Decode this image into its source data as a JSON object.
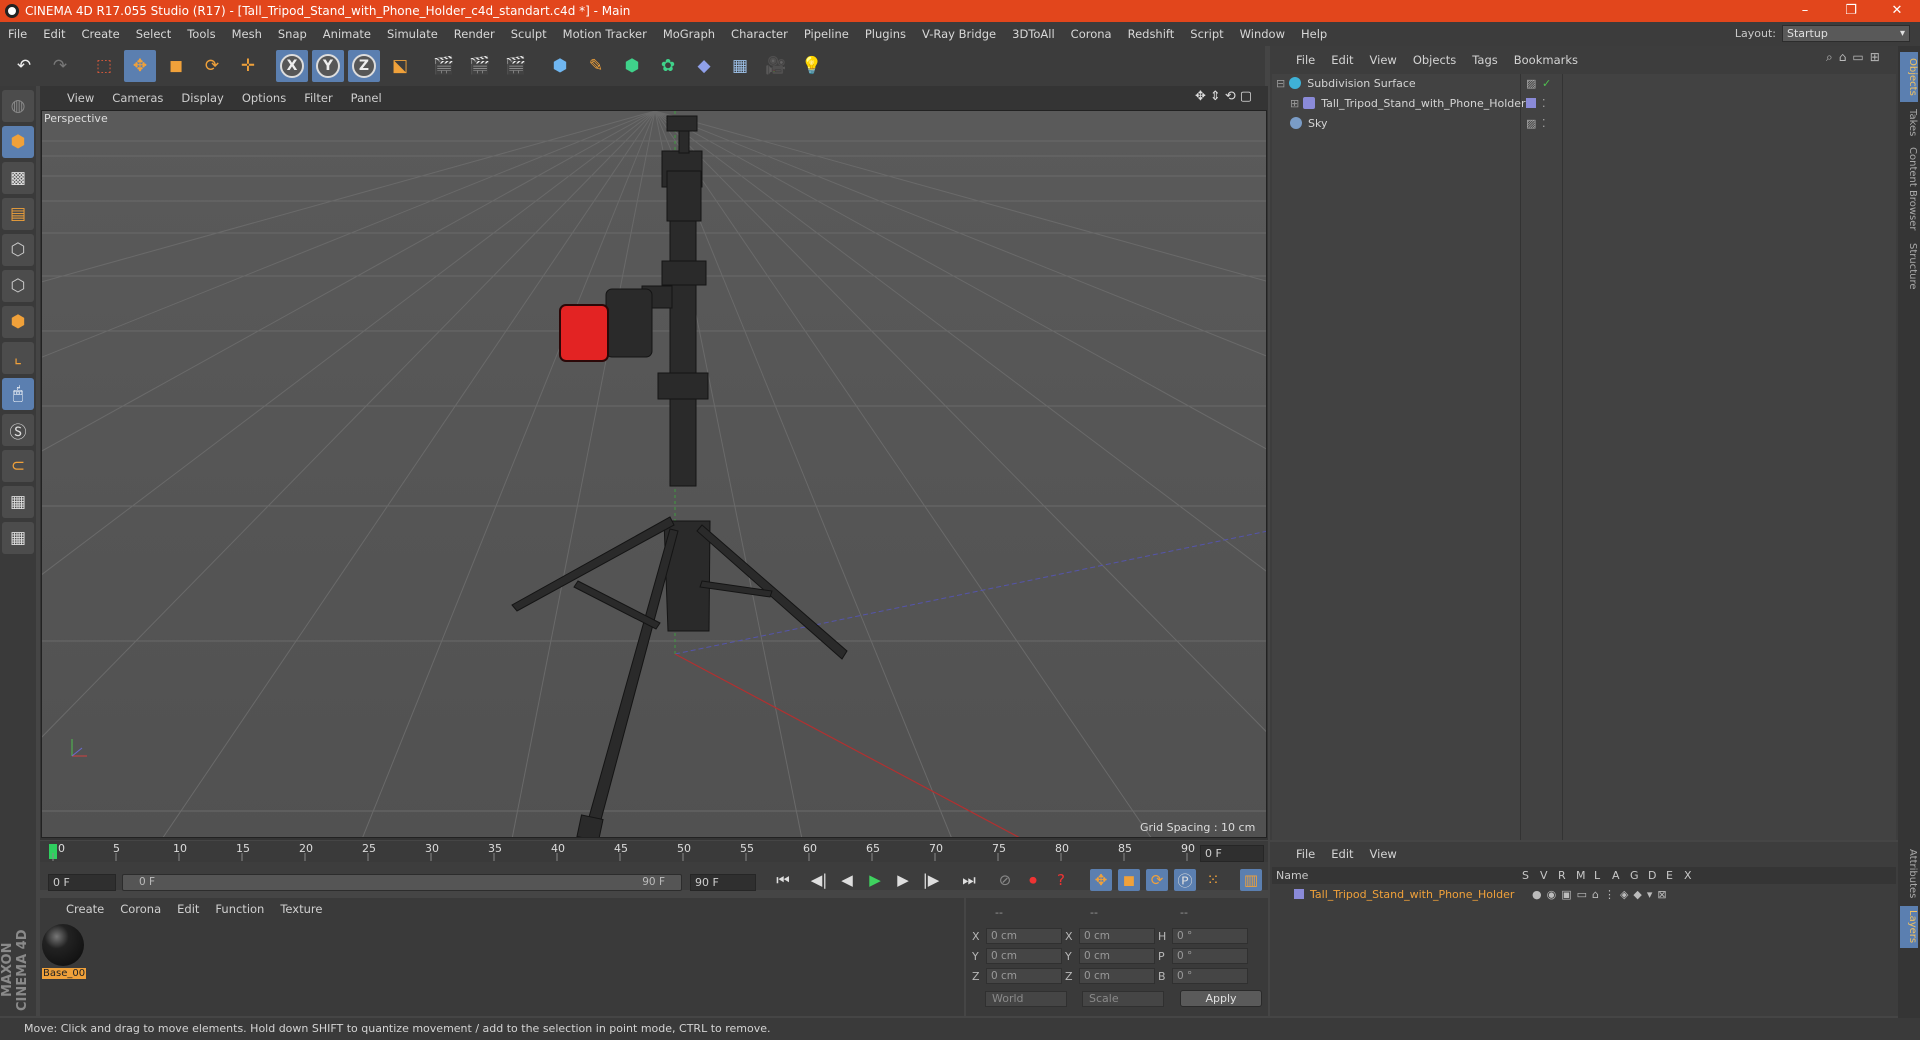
{
  "window": {
    "title": "CINEMA 4D R17.055 Studio (R17) - [Tall_Tripod_Stand_with_Phone_Holder_c4d_standart.c4d *] - Main",
    "controls": [
      "–",
      "❐",
      "✕"
    ]
  },
  "menubar": {
    "items": [
      "File",
      "Edit",
      "Create",
      "Select",
      "Tools",
      "Mesh",
      "Snap",
      "Animate",
      "Simulate",
      "Render",
      "Sculpt",
      "Motion Tracker",
      "MoGraph",
      "Character",
      "Pipeline",
      "Plugins",
      "V-Ray Bridge",
      "3DToAll",
      "Corona",
      "Redshift",
      "Script",
      "Window",
      "Help"
    ],
    "layout_label": "Layout:",
    "layout_value": "Startup"
  },
  "viewport": {
    "menu": [
      "View",
      "Cameras",
      "Display",
      "Options",
      "Filter",
      "Panel"
    ],
    "label": "Perspective",
    "grid_spacing": "Grid Spacing : 10 cm"
  },
  "timeline": {
    "ticks": [
      "0",
      "5",
      "10",
      "15",
      "20",
      "25",
      "30",
      "35",
      "40",
      "45",
      "50",
      "55",
      "60",
      "65",
      "70",
      "75",
      "80",
      "85",
      "90"
    ],
    "current_frame": "0 F",
    "start_field": "0 F",
    "range_start": "0 F",
    "range_end": "90 F",
    "end_field": "90 F"
  },
  "material_panel": {
    "menu": [
      "Create",
      "Corona",
      "Edit",
      "Function",
      "Texture"
    ],
    "materials": [
      {
        "name": "Base_00"
      }
    ]
  },
  "coordinates": {
    "headers": [
      "--",
      "--",
      "--"
    ],
    "rows": [
      {
        "a": "X",
        "av": "0 cm",
        "b": "X",
        "bv": "0 cm",
        "c": "H",
        "cv": "0 °"
      },
      {
        "a": "Y",
        "av": "0 cm",
        "b": "Y",
        "bv": "0 cm",
        "c": "P",
        "cv": "0 °"
      },
      {
        "a": "Z",
        "av": "0 cm",
        "b": "Z",
        "bv": "0 cm",
        "c": "B",
        "cv": "0 °"
      }
    ],
    "mode": "World",
    "scale": "Scale",
    "apply": "Apply"
  },
  "object_manager": {
    "menu": [
      "File",
      "Edit",
      "View",
      "Objects",
      "Tags",
      "Bookmarks"
    ],
    "objects": [
      {
        "name": "Subdivision Surface",
        "icon": "#3fb1d6"
      },
      {
        "name": "Tall_Tripod_Stand_with_Phone_Holder",
        "icon": "#8a8ad8"
      },
      {
        "name": "Sky",
        "icon": "#7a9cc6"
      }
    ]
  },
  "right_tabs": [
    "Objects",
    "Takes",
    "Content Browser",
    "Structure",
    "Attributes",
    "Layers"
  ],
  "layer_manager": {
    "menu": [
      "File",
      "Edit",
      "View"
    ],
    "columns": [
      "Name",
      "S",
      "V",
      "R",
      "M",
      "L",
      "A",
      "G",
      "D",
      "E",
      "X"
    ],
    "layers": [
      {
        "name": "Tall_Tripod_Stand_with_Phone_Holder",
        "color": "#8a8ad8"
      }
    ]
  },
  "statusbar": {
    "text": "Move: Click and drag to move elements. Hold down SHIFT to quantize movement / add to the selection in point mode, CTRL to remove."
  },
  "logo": {
    "text": "MAXON CINEMA 4D"
  },
  "colors": {
    "title_bar": "#e2461c",
    "selection_blue": "#5b7fb0",
    "accent_orange": "#f0a13a"
  }
}
